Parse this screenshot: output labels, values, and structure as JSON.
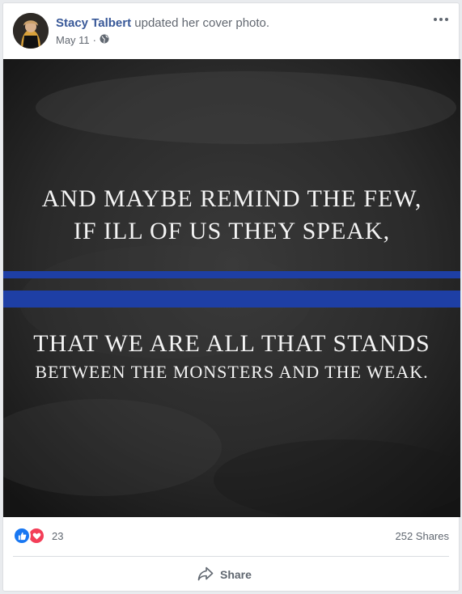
{
  "post": {
    "author": "Stacy Talbert",
    "action": "updated her cover photo.",
    "date": "May 11",
    "date_separator": "·",
    "privacy_icon": "globe-icon",
    "more_icon": "more-options-icon"
  },
  "photo": {
    "line1": "AND MAYBE REMIND THE FEW,",
    "line2": "IF ILL OF US THEY SPEAK,",
    "line3": "THAT WE ARE ALL THAT STANDS",
    "line4": "BETWEEN THE MONSTERS AND THE WEAK.",
    "stripe_color": "#1e3fa5",
    "background_color": "#262626"
  },
  "stats": {
    "reaction_icons": [
      "like-icon",
      "love-icon"
    ],
    "reaction_count": "23",
    "shares": "252 Shares"
  },
  "actions": {
    "share_label": "Share",
    "share_icon": "share-icon"
  },
  "colors": {
    "link": "#385898",
    "like": "#1877f2",
    "love": "#f33e58"
  }
}
